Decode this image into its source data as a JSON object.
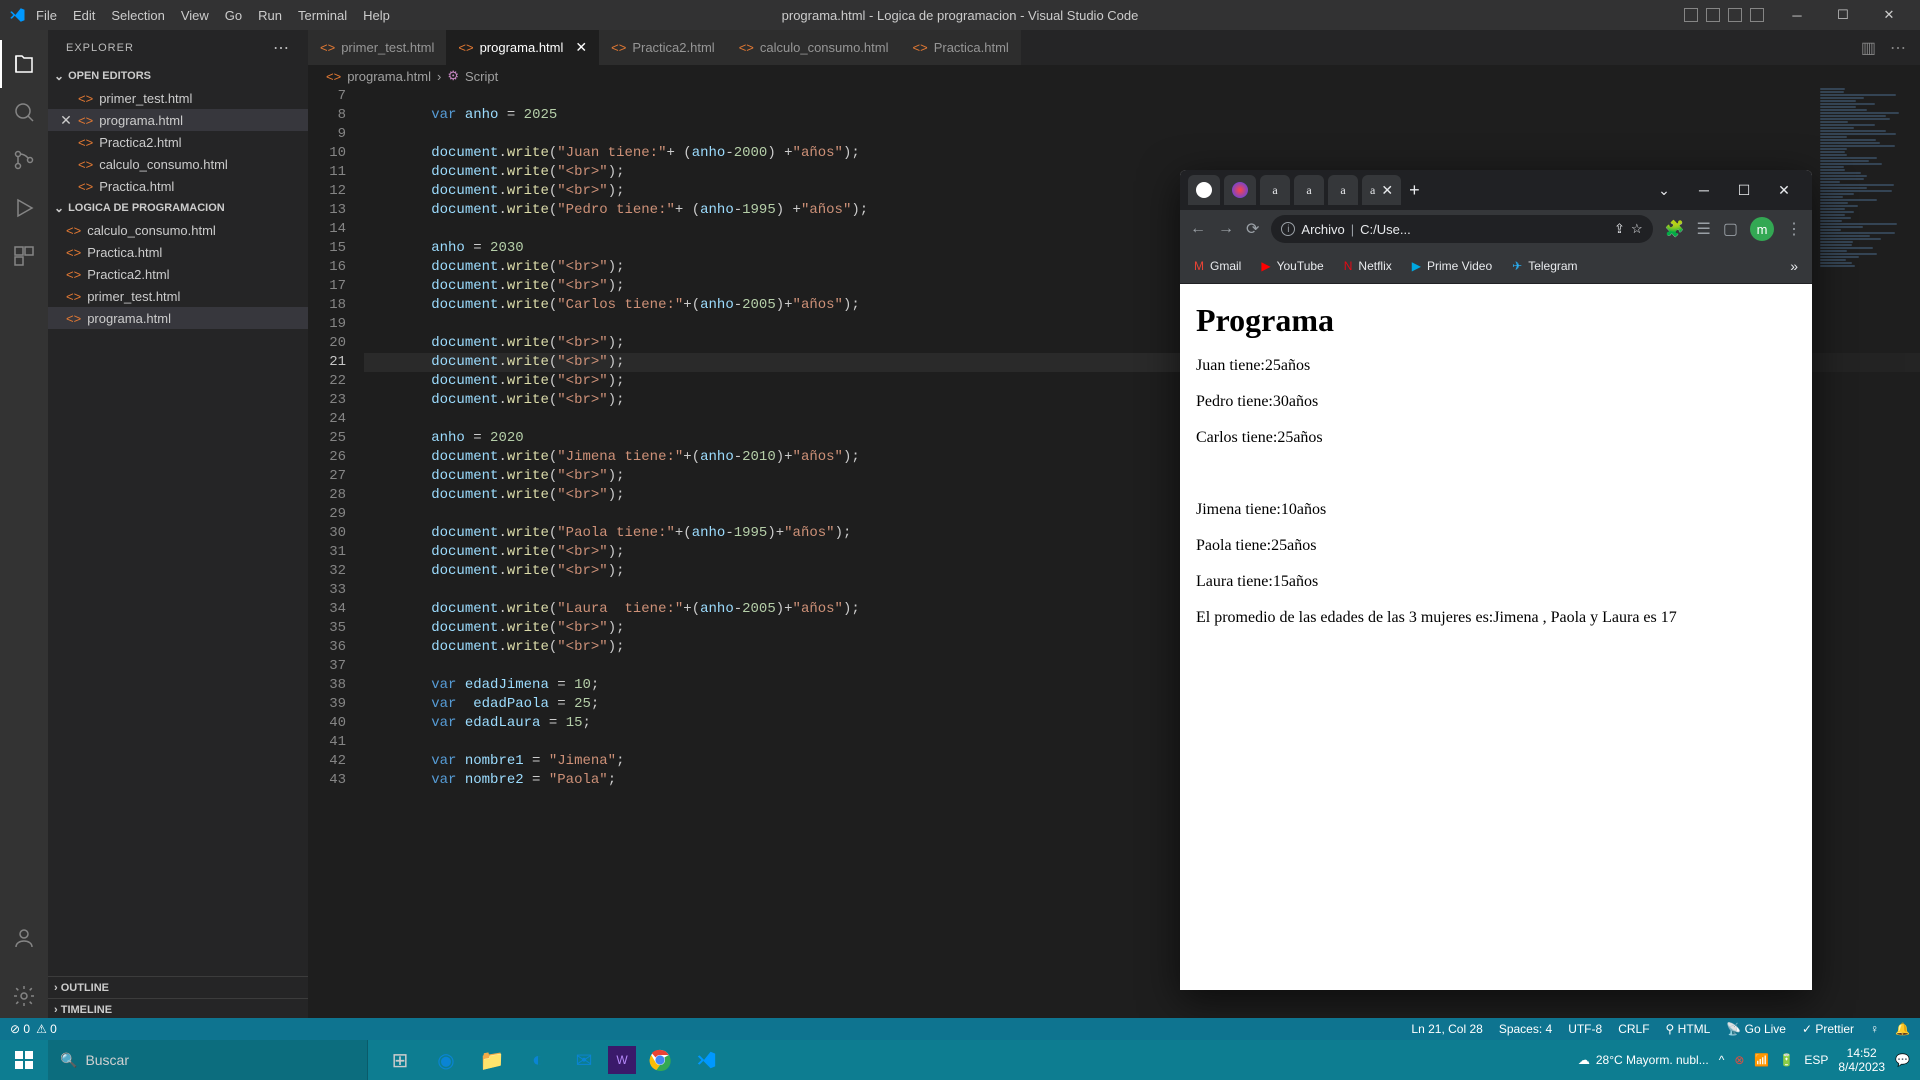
{
  "titlebar": {
    "menu": [
      "File",
      "Edit",
      "Selection",
      "View",
      "Go",
      "Run",
      "Terminal",
      "Help"
    ],
    "title": "programa.html - Logica de programacion - Visual Studio Code"
  },
  "sidebar": {
    "header": "EXPLORER",
    "open_editors_label": "OPEN EDITORS",
    "open_editors": [
      "primer_test.html",
      "programa.html",
      "Practica2.html",
      "calculo_consumo.html",
      "Practica.html"
    ],
    "folder_label": "LOGICA DE PROGRAMACION",
    "folder_items": [
      "calculo_consumo.html",
      "Practica.html",
      "Practica2.html",
      "primer_test.html",
      "programa.html"
    ],
    "outline": "OUTLINE",
    "timeline": "TIMELINE"
  },
  "tabs": [
    "primer_test.html",
    "programa.html",
    "Practica2.html",
    "calculo_consumo.html",
    "Practica.html"
  ],
  "breadcrumb": {
    "file": "programa.html",
    "symbol": "Script"
  },
  "code": {
    "start": 7,
    "current": 21,
    "lines": [
      "",
      "        var anho = 2025",
      "",
      "        document.write(\"Juan tiene:\"+ (anho-2000) +\"años\");",
      "        document.write(\"<br>\");",
      "        document.write(\"<br>\");",
      "        document.write(\"Pedro tiene:\"+ (anho-1995) +\"años\");",
      "",
      "        anho = 2030",
      "        document.write(\"<br>\");",
      "        document.write(\"<br>\");",
      "        document.write(\"Carlos tiene:\"+(anho-2005)+\"años\");",
      "",
      "        document.write(\"<br>\");",
      "        document.write(\"<br>\");",
      "        document.write(\"<br>\");",
      "        document.write(\"<br>\");",
      "",
      "        anho = 2020",
      "        document.write(\"Jimena tiene:\"+(anho-2010)+\"años\");",
      "        document.write(\"<br>\");",
      "        document.write(\"<br>\");",
      "",
      "        document.write(\"Paola tiene:\"+(anho-1995)+\"años\");",
      "        document.write(\"<br>\");",
      "        document.write(\"<br>\");",
      "",
      "        document.write(\"Laura  tiene:\"+(anho-2005)+\"años\");",
      "        document.write(\"<br>\");",
      "        document.write(\"<br>\");",
      "",
      "        var edadJimena = 10;",
      "        var  edadPaola = 25;",
      "        var edadLaura = 15;",
      "",
      "        var nombre1 = \"Jimena\";",
      "        var nombre2 = \"Paola\";"
    ]
  },
  "browser": {
    "addr_label": "Archivo",
    "addr_path": "C:/Use...",
    "bookmarks": [
      "Gmail",
      "YouTube",
      "Netflix",
      "Prime Video",
      "Telegram"
    ],
    "page_title": "Programa",
    "page_lines": [
      "Juan tiene:25años",
      "Pedro tiene:30años",
      "Carlos tiene:25años",
      "",
      "Jimena tiene:10años",
      "Paola tiene:25años",
      "Laura tiene:15años",
      "El promedio de las edades de las 3 mujeres es:Jimena , Paola y Laura es 17"
    ],
    "avatar_letter": "m"
  },
  "status": {
    "errors": "0",
    "warnings": "0",
    "pos": "Ln 21, Col 28",
    "spaces": "Spaces: 4",
    "enc": "UTF-8",
    "eol": "CRLF",
    "lang": "HTML",
    "golive": "Go Live",
    "prettier": "Prettier"
  },
  "taskbar": {
    "search_placeholder": "Buscar",
    "weather": "28°C  Mayorm. nubl...",
    "lang": "ESP",
    "time": "14:52",
    "date": "8/4/2023"
  }
}
